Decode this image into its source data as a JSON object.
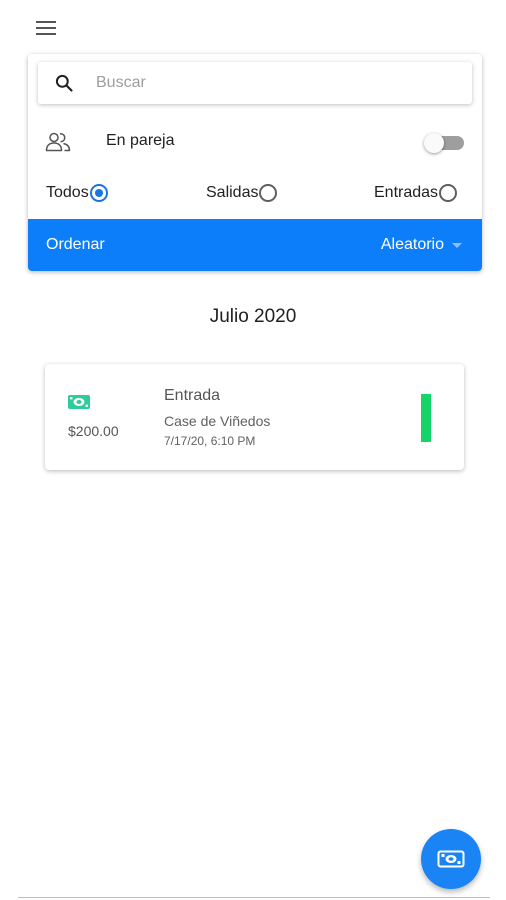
{
  "colors": {
    "accent_blue": "#0d7ef9",
    "radio_selected": "#1a73e8",
    "income_green": "#15d46a",
    "fab_blue": "#1a84f5"
  },
  "toolbar": {
    "menu_icon": "hamburger-menu-icon"
  },
  "filters": {
    "search": {
      "icon": "search-icon",
      "placeholder": "Buscar",
      "value": ""
    },
    "couple": {
      "icon": "people-icon",
      "label": "En pareja",
      "enabled": false
    },
    "type_options": [
      {
        "label": "Todos",
        "selected": true
      },
      {
        "label": "Salidas",
        "selected": false
      },
      {
        "label": "Entradas",
        "selected": false
      }
    ],
    "sort": {
      "label": "Ordenar",
      "value": "Aleatorio"
    }
  },
  "month": "Julio 2020",
  "transactions": [
    {
      "icon": "money-icon",
      "amount": "$200.00",
      "type": "Entrada",
      "place": "Case de Viñedos",
      "date": "7/17/20, 6:10 PM"
    }
  ],
  "fab": {
    "icon": "money-icon"
  }
}
